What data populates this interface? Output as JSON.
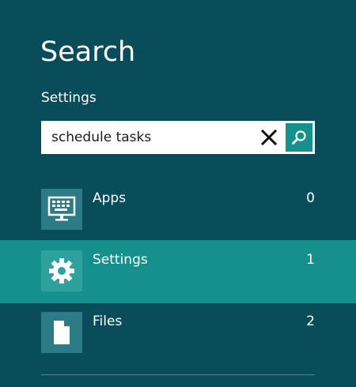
{
  "pane": {
    "title": "Search",
    "scope_label": "Settings"
  },
  "search": {
    "value": "schedule tasks",
    "clear_icon": "close-icon",
    "submit_icon": "search-icon"
  },
  "results": [
    {
      "label": "Apps",
      "count": "0",
      "icon": "apps-keyboard-icon",
      "selected": false
    },
    {
      "label": "Settings",
      "count": "1",
      "icon": "gear-icon",
      "selected": true
    },
    {
      "label": "Files",
      "count": "2",
      "icon": "document-icon",
      "selected": false
    }
  ],
  "colors": {
    "background": "#0a4d5a",
    "accent": "#15908c",
    "tile": "#2c7b86"
  }
}
